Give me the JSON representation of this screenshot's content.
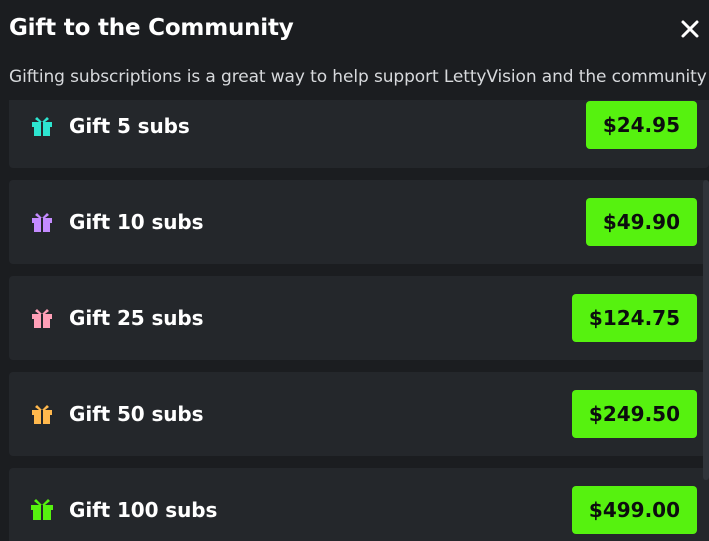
{
  "dialog": {
    "title": "Gift to the Community",
    "subtitle": "Gifting subscriptions is a great way to help support LettyVision and the community"
  },
  "close_icon": "close-icon",
  "accent_color": "#56f20f",
  "options": [
    {
      "label": "Gift 5 subs",
      "price": "$24.95",
      "icon": "gift-icon",
      "icon_color": "#2de5d0"
    },
    {
      "label": "Gift 10 subs",
      "price": "$49.90",
      "icon": "gift-icon",
      "icon_color": "#c48bff"
    },
    {
      "label": "Gift 25 subs",
      "price": "$124.75",
      "icon": "gift-icon",
      "icon_color": "#ff9fb7"
    },
    {
      "label": "Gift 50 subs",
      "price": "$249.50",
      "icon": "gift-icon",
      "icon_color": "#ffb84d"
    },
    {
      "label": "Gift 100 subs",
      "price": "$499.00",
      "icon": "gift-icon",
      "icon_color": "#56f20f"
    }
  ]
}
